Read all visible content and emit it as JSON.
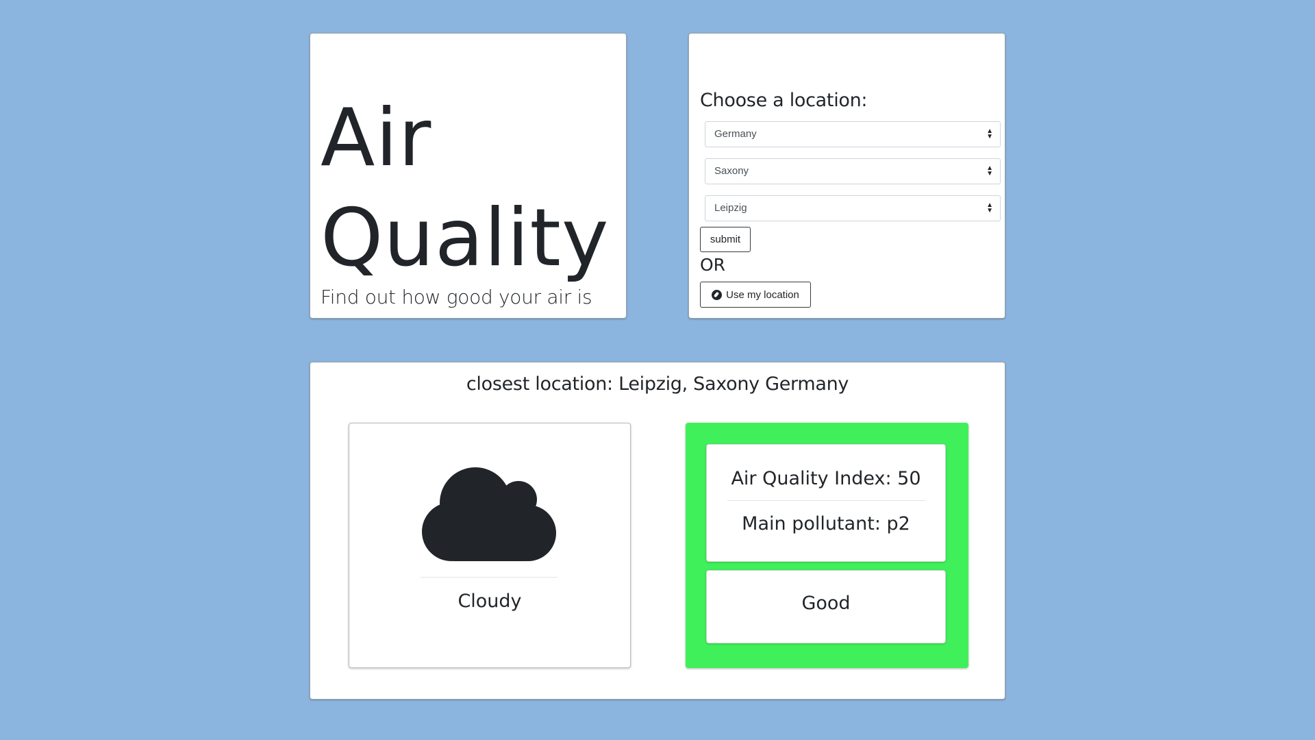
{
  "title": {
    "line1": "Air",
    "line2": "Quality",
    "subtitle": "Find out how good your air is"
  },
  "location_form": {
    "label": "Choose a location:",
    "country_selected": "Germany",
    "state_selected": "Saxony",
    "city_selected": "Leipzig",
    "submit_label": "submit",
    "or_text": "OR",
    "use_location_label": "Use my location",
    "use_location_icon": "compass-icon"
  },
  "results": {
    "closest_location": "closest location: Leipzig, Saxony Germany",
    "weather": {
      "icon": "cloud-icon",
      "condition": "Cloudy"
    },
    "air_quality": {
      "index_text": "Air Quality Index: 50",
      "pollutant_text": "Main pollutant: p2",
      "status": "Good",
      "status_color": "#40f05a"
    }
  },
  "colors": {
    "background": "#8bb4df",
    "card": "#ffffff",
    "text": "#212529"
  }
}
